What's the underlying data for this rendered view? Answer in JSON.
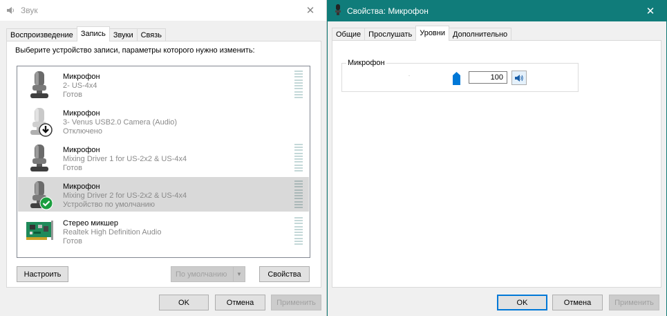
{
  "left_window": {
    "title": "Звук",
    "tabs": [
      "Воспроизведение",
      "Запись",
      "Звуки",
      "Связь"
    ],
    "active_tab": "Запись",
    "instruction": "Выберите устройство записи, параметры которого нужно изменить:",
    "devices": [
      {
        "name": "Микрофон",
        "description": "2- US-4x4",
        "status": "Готов",
        "selected": false,
        "icon": "microphone-icon"
      },
      {
        "name": "Микрофон",
        "description": "3- Venus USB2.0 Camera (Audio)",
        "status": "Отключено",
        "selected": false,
        "icon": "microphone-disabled-icon"
      },
      {
        "name": "Микрофон",
        "description": "Mixing Driver 1 for US-2x2 & US-4x4",
        "status": "Готов",
        "selected": false,
        "icon": "microphone-icon"
      },
      {
        "name": "Микрофон",
        "description": "Mixing Driver 2 for US-2x2 & US-4x4",
        "status": "Устройство по умолчанию",
        "selected": true,
        "icon": "microphone-default-icon"
      },
      {
        "name": "Стерео микшер",
        "description": "Realtek High Definition Audio",
        "status": "Готов",
        "selected": false,
        "icon": "sound-card-icon"
      }
    ],
    "buttons": {
      "configure": "Настроить",
      "set_default": "По умолчанию",
      "properties": "Свойства",
      "ok": "OK",
      "cancel": "Отмена",
      "apply": "Применить"
    }
  },
  "right_window": {
    "title": "Свойства: Микрофон",
    "tabs": [
      "Общие",
      "Прослушать",
      "Уровни",
      "Дополнительно"
    ],
    "active_tab": "Уровни",
    "levels": {
      "label": "Микрофон",
      "value": "100",
      "slider_fraction": 1.0
    },
    "buttons": {
      "ok": "OK",
      "cancel": "Отмена",
      "apply": "Применить"
    }
  },
  "colors": {
    "accent": "#0078d7",
    "titlebar_active": "#107c7a",
    "selection": "#d9d9d9"
  }
}
